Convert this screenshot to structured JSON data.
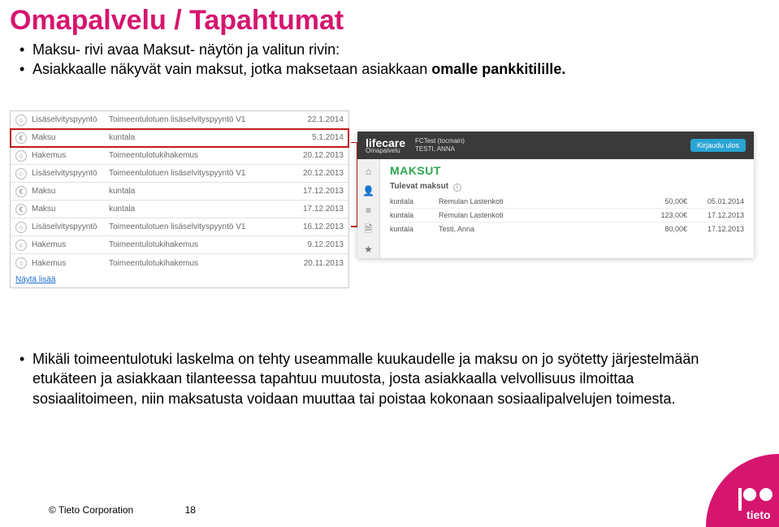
{
  "title": "Omapalvelu / Tapahtumat",
  "top_bullets": [
    "Maksu- rivi avaa Maksut- näytön ja valitun rivin:",
    "Asiakkaalle näkyvät vain maksut, jotka maksetaan asiakkaan"
  ],
  "top_bold_line": "omalle pankkitilille.",
  "left_rows": [
    {
      "icon": "○",
      "type": "Lisäselvityspyyntö",
      "desc": "Toimeentulotuen lisäselvityspyyntö V1",
      "date": "22.1.2014",
      "hi": false
    },
    {
      "icon": "€",
      "type": "Maksu",
      "desc": "kuntala",
      "date": "5.1.2014",
      "hi": true
    },
    {
      "icon": "○",
      "type": "Hakemus",
      "desc": "Toimeentulotukihakemus",
      "date": "20.12.2013",
      "hi": false
    },
    {
      "icon": "○",
      "type": "Lisäselvityspyyntö",
      "desc": "Toimeentulotuen lisäselvityspyyntö V1",
      "date": "20.12.2013",
      "hi": false
    },
    {
      "icon": "€",
      "type": "Maksu",
      "desc": "kuntala",
      "date": "17.12.2013",
      "hi": false
    },
    {
      "icon": "€",
      "type": "Maksu",
      "desc": "kuntala",
      "date": "17.12.2013",
      "hi": false
    },
    {
      "icon": "○",
      "type": "Lisäselvityspyyntö",
      "desc": "Toimeentulotuen lisäselvityspyyntö V1",
      "date": "16.12.2013",
      "hi": false
    },
    {
      "icon": "○",
      "type": "Hakemus",
      "desc": "Toimeentulotukihakemus",
      "date": "9.12.2013",
      "hi": false
    },
    {
      "icon": "○",
      "type": "Hakemus",
      "desc": "Toimeentulotukihakemus",
      "date": "20.11.2013",
      "hi": false
    }
  ],
  "left_footer_link": "Näytä lisää",
  "right": {
    "brand": "lifecare",
    "brand_sub": "Omapalvelu",
    "meta1": "FCTest (tocmain)",
    "meta2": "TESTI, ANNA",
    "logout": "Kirjaudu ulos",
    "title": "MAKSUT",
    "subtitle": "Tulevat maksut",
    "rows": [
      {
        "c1": "kuntala",
        "c2": "Remulan Lastenkoti",
        "c3": "50,00€",
        "c4": "05.01.2014"
      },
      {
        "c1": "kuntala",
        "c2": "Remulan Lastenkoti",
        "c3": "123,00€",
        "c4": "17.12.2013"
      },
      {
        "c1": "kuntala",
        "c2": "Testi, Anna",
        "c3": "80,00€",
        "c4": "17.12.2013"
      }
    ]
  },
  "lower_bullet": "Mikäli toimeentulotuki laskelma on tehty useammalle kuukaudelle ja maksu on jo syötetty järjestelmään etukäteen ja  asiakkaan tilanteessa tapahtuu muutosta, josta asiakkaalla velvollisuus ilmoittaa sosiaalitoimeen, niin maksatusta voidaan muuttaa tai poistaa kokonaan sosiaalipalvelujen toimesta.",
  "footer": {
    "copyright": "© Tieto Corporation",
    "page": "18"
  }
}
